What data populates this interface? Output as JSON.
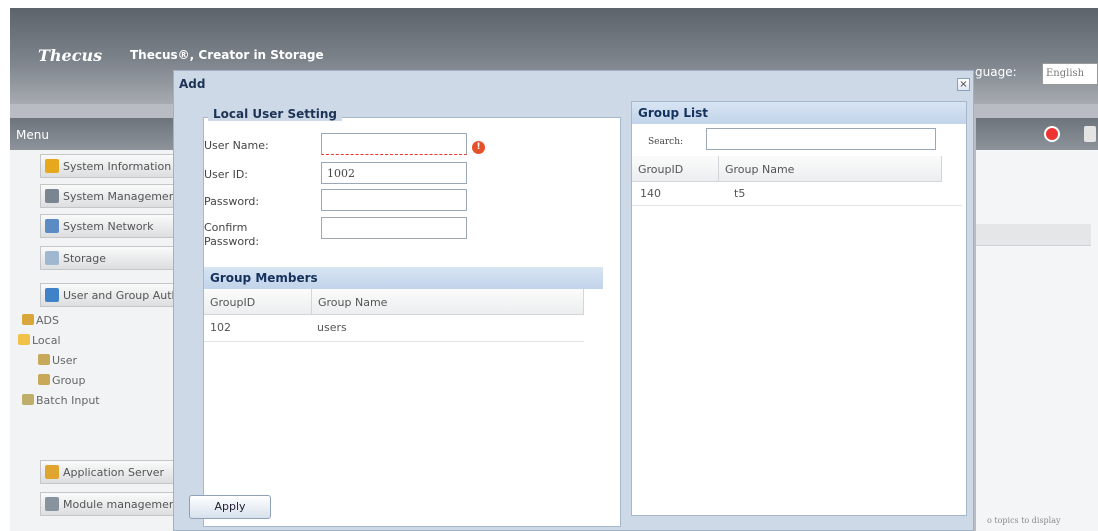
{
  "app": {
    "logo": "Thecus",
    "tagline": "Thecus®, Creator in Storage",
    "language_label": "guage:",
    "language_value": "English",
    "menu_title": "Menu",
    "no_topics": "o topics to display"
  },
  "sidebar": {
    "items": [
      {
        "label": "System Information"
      },
      {
        "label": "System Management"
      },
      {
        "label": "System Network"
      },
      {
        "label": "Storage"
      },
      {
        "label": "User and Group Auth"
      },
      {
        "label": "Application Server"
      },
      {
        "label": "Module management"
      }
    ],
    "tree": [
      {
        "label": "ADS"
      },
      {
        "label": "Local"
      },
      {
        "label": "User"
      },
      {
        "label": "Group"
      },
      {
        "label": "Batch Input"
      }
    ]
  },
  "dialog": {
    "title": "Add",
    "close_glyph": "×",
    "local_user_setting": {
      "legend": "Local User Setting",
      "fields": [
        {
          "label": "User Name:",
          "value": ""
        },
        {
          "label": "User ID:",
          "value": "1002"
        },
        {
          "label": "Password:",
          "value": ""
        },
        {
          "label_line1": "Confirm",
          "label_line2": "Password:",
          "value": ""
        }
      ]
    },
    "group_members": {
      "title": "Group Members",
      "columns": [
        "GroupID",
        "Group Name"
      ],
      "rows": [
        {
          "id": "102",
          "name": "users"
        }
      ]
    },
    "group_list": {
      "title": "Group List",
      "search_label": "Search:",
      "search_value": "",
      "columns": [
        "GroupID",
        "Group Name"
      ],
      "rows": [
        {
          "id": "140",
          "name": "t5"
        }
      ]
    },
    "apply_label": "Apply"
  }
}
